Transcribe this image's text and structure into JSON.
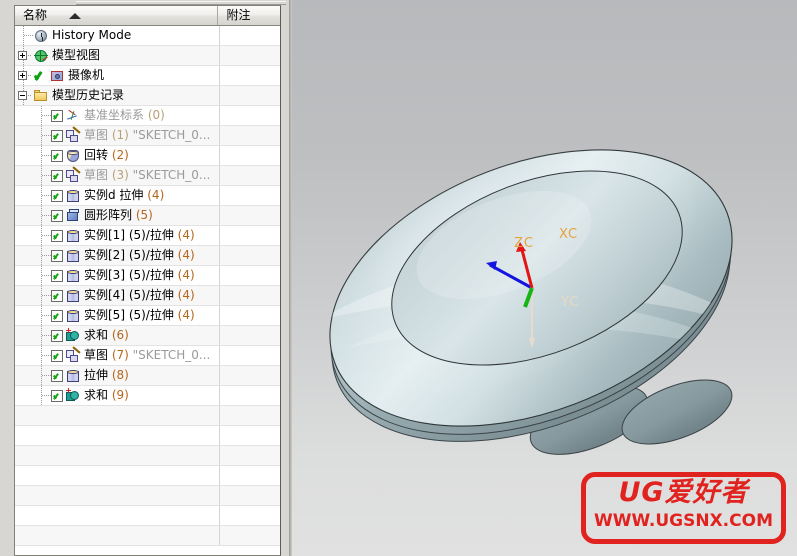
{
  "panel": {
    "columns": [
      {
        "label": "名称",
        "sort": "ascending"
      },
      {
        "label": "附注"
      }
    ]
  },
  "tree": {
    "items": [
      {
        "indent": 0,
        "expander": "none",
        "check": false,
        "icon": "clock-icon",
        "label": "History Mode",
        "num": "",
        "suffix": "",
        "dim": false
      },
      {
        "indent": 0,
        "expander": "plus",
        "check": false,
        "icon": "model-view-icon",
        "label": "模型视图",
        "num": "",
        "suffix": "",
        "dim": false
      },
      {
        "indent": 0,
        "expander": "plus",
        "check": "bare",
        "icon": "camera-icon",
        "label": "摄像机",
        "num": "",
        "suffix": "",
        "dim": false
      },
      {
        "indent": 0,
        "expander": "minus",
        "check": false,
        "icon": "folder-icon",
        "label": "模型历史记录",
        "num": "",
        "suffix": "",
        "dim": false
      },
      {
        "indent": 1,
        "expander": "none",
        "check": true,
        "icon": "datum-csys-icon",
        "label": "基准坐标系",
        "num": "(0)",
        "suffix": "",
        "dim": true
      },
      {
        "indent": 1,
        "expander": "none",
        "check": true,
        "icon": "sketch-icon",
        "label": "草图",
        "num": "(1)",
        "suffix": "\"SKETCH_0...",
        "dim": true
      },
      {
        "indent": 1,
        "expander": "none",
        "check": true,
        "icon": "revolve-icon",
        "label": "回转",
        "num": "(2)",
        "suffix": "",
        "dim": false
      },
      {
        "indent": 1,
        "expander": "none",
        "check": true,
        "icon": "sketch-icon",
        "label": "草图",
        "num": "(3)",
        "suffix": "\"SKETCH_0...",
        "dim": true
      },
      {
        "indent": 1,
        "expander": "none",
        "check": true,
        "icon": "extrude-icon",
        "label": "实例d 拉伸",
        "num": "(4)",
        "suffix": "",
        "dim": false
      },
      {
        "indent": 1,
        "expander": "none",
        "check": true,
        "icon": "pattern-icon",
        "label": "圆形阵列",
        "num": "(5)",
        "suffix": "",
        "dim": false
      },
      {
        "indent": 1,
        "expander": "none",
        "check": true,
        "icon": "extrude-icon",
        "label": "实例[1] (5)/拉伸",
        "num": "(4)",
        "suffix": "",
        "dim": false
      },
      {
        "indent": 1,
        "expander": "none",
        "check": true,
        "icon": "extrude-icon",
        "label": "实例[2] (5)/拉伸",
        "num": "(4)",
        "suffix": "",
        "dim": false
      },
      {
        "indent": 1,
        "expander": "none",
        "check": true,
        "icon": "extrude-icon",
        "label": "实例[3] (5)/拉伸",
        "num": "(4)",
        "suffix": "",
        "dim": false
      },
      {
        "indent": 1,
        "expander": "none",
        "check": true,
        "icon": "extrude-icon",
        "label": "实例[4] (5)/拉伸",
        "num": "(4)",
        "suffix": "",
        "dim": false
      },
      {
        "indent": 1,
        "expander": "none",
        "check": true,
        "icon": "extrude-icon",
        "label": "实例[5] (5)/拉伸",
        "num": "(4)",
        "suffix": "",
        "dim": false
      },
      {
        "indent": 1,
        "expander": "none",
        "check": true,
        "icon": "unite-icon",
        "label": "求和",
        "num": "(6)",
        "suffix": "",
        "dim": false
      },
      {
        "indent": 1,
        "expander": "none",
        "check": true,
        "icon": "sketch-icon",
        "label": "草图",
        "num": "(7)",
        "suffix": "\"SKETCH_0...",
        "dim": false
      },
      {
        "indent": 1,
        "expander": "none",
        "check": true,
        "icon": "extrude-icon",
        "label": "拉伸",
        "num": "(8)",
        "suffix": "",
        "dim": false
      },
      {
        "indent": 1,
        "expander": "none",
        "check": true,
        "icon": "unite-icon",
        "label": "求和",
        "num": "(9)",
        "suffix": "",
        "dim": false
      }
    ],
    "empty_rows": 7
  },
  "viewport": {
    "triad": {
      "x_label": "XC",
      "y_label": "YC",
      "z_label": "ZC",
      "x_color": "#e41414",
      "y_color": "#16b416",
      "z_color": "#1414e0",
      "label_color": "#e8a23c"
    },
    "background_top": "#b7b9bc",
    "background_bottom": "#e1e1e1",
    "model_color": "#c9d9dd"
  },
  "watermark": {
    "top_text": "UG爱好者",
    "bottom_text": "WWW.UGSNX.COM",
    "color": "#e0231f"
  }
}
